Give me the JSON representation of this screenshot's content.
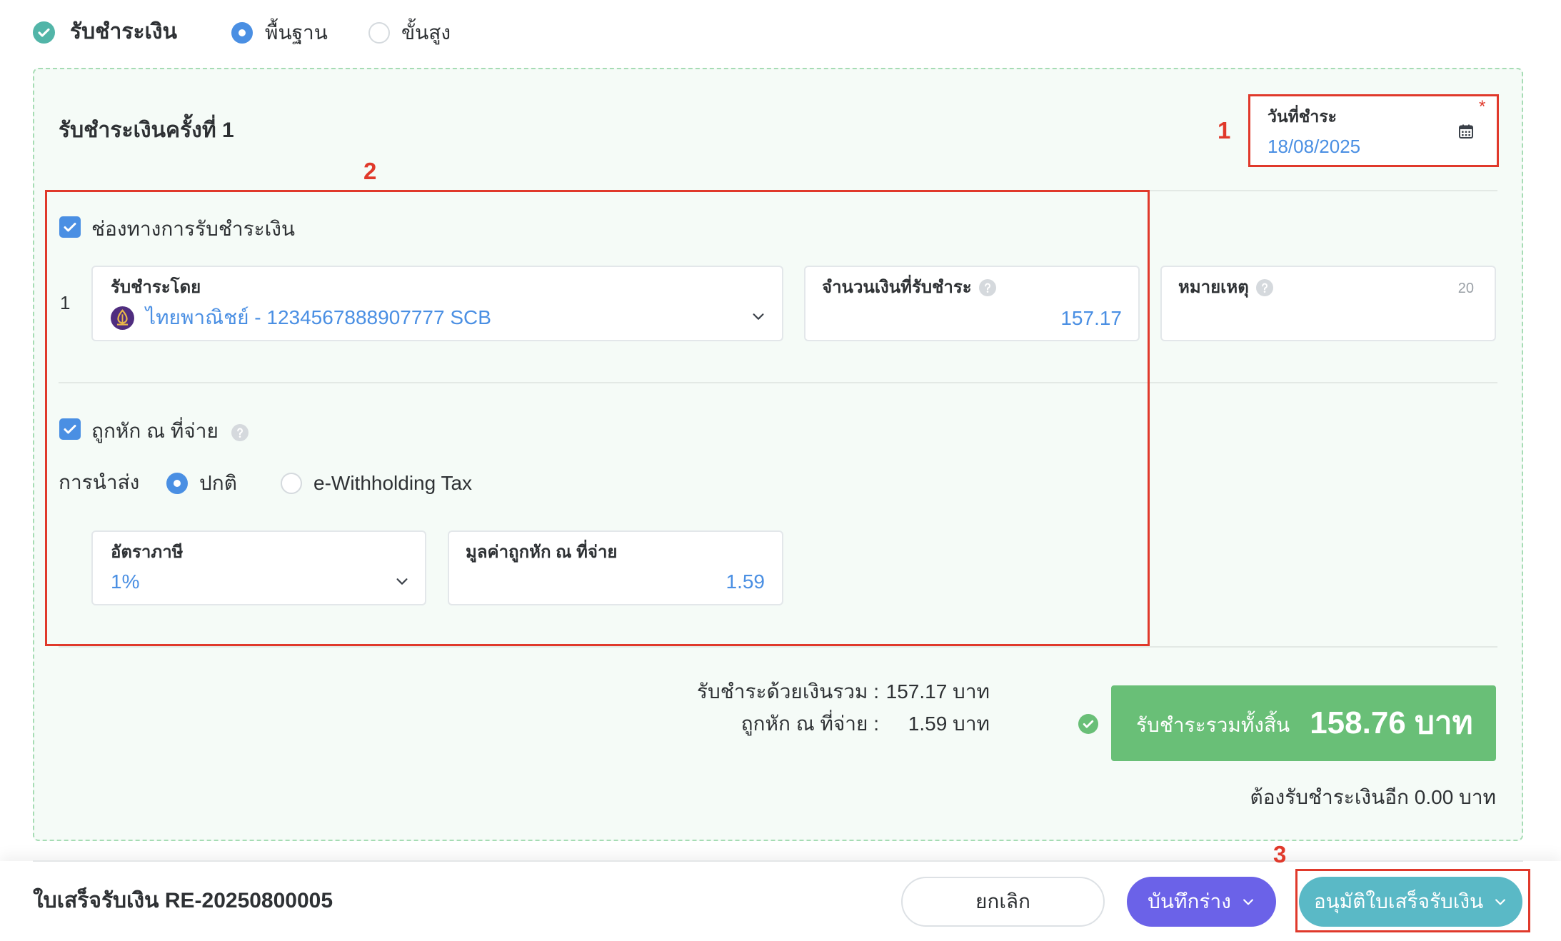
{
  "header": {
    "title": "รับชำระเงิน",
    "mode_options": [
      {
        "label": "พื้นฐาน",
        "selected": true
      },
      {
        "label": "ขั้นสูง",
        "selected": false
      }
    ]
  },
  "payment": {
    "title": "รับชำระเงินครั้งที่ 1",
    "date_field": {
      "label": "วันที่ชำระ",
      "required_mark": "*",
      "value": "18/08/2025"
    },
    "channel": {
      "checkbox_label": "ช่องทางการรับชำระเงิน",
      "checked": true,
      "rows": [
        {
          "index": "1",
          "method": {
            "label": "รับชำระโดย",
            "value": "ไทยพาณิชย์ - 1234567888907777 SCB"
          },
          "amount": {
            "label": "จำนวนเงินที่รับชำระ",
            "value": "157.17"
          },
          "note": {
            "label": "หมายเหตุ",
            "counter": "20"
          }
        }
      ]
    },
    "withholding": {
      "checkbox_label": "ถูกหัก ณ ที่จ่าย",
      "checked": true,
      "submit_label": "การนำส่ง",
      "submit_options": [
        {
          "label": "ปกติ",
          "selected": true
        },
        {
          "label": "e-Withholding Tax",
          "selected": false
        }
      ],
      "tax_rate": {
        "label": "อัตราภาษี",
        "value": "1%"
      },
      "amount": {
        "label": "มูลค่าถูกหัก ณ ที่จ่าย",
        "value": "1.59"
      }
    },
    "summary": {
      "cash_total_label": "รับชำระด้วยเงินรวม :",
      "cash_total_value": "157.17 บาท",
      "withholding_label": "ถูกหัก ณ ที่จ่าย :",
      "withholding_value": "1.59 บาท",
      "grand_total_label": "รับชำระรวมทั้งสิ้น",
      "grand_total_value": "158.76 บาท",
      "remaining": "ต้องรับชำระเงินอีก 0.00 บาท"
    }
  },
  "footer": {
    "document_title": "ใบเสร็จรับเงิน RE-20250800005",
    "cancel_label": "ยกเลิก",
    "draft_label": "บันทึกร่าง",
    "approve_label": "อนุมัติใบเสร็จรับเงิน"
  },
  "annotations": [
    {
      "label": "1"
    },
    {
      "label": "2"
    },
    {
      "label": "3"
    }
  ],
  "icons": {
    "payment_toggle": "check-circle-icon",
    "date": "calendar-icon",
    "bank": "scb-bank-icon",
    "dropdown": "chevron-down-icon",
    "help": "help-circle-icon",
    "balanced": "check-circle-icon"
  },
  "colors": {
    "accent": "#4a8fe3",
    "success": "#69bf77",
    "draft": "#6b62e8",
    "approve": "#5ab9c6",
    "annotation": "#e0392b",
    "status": "#52b5a8"
  }
}
